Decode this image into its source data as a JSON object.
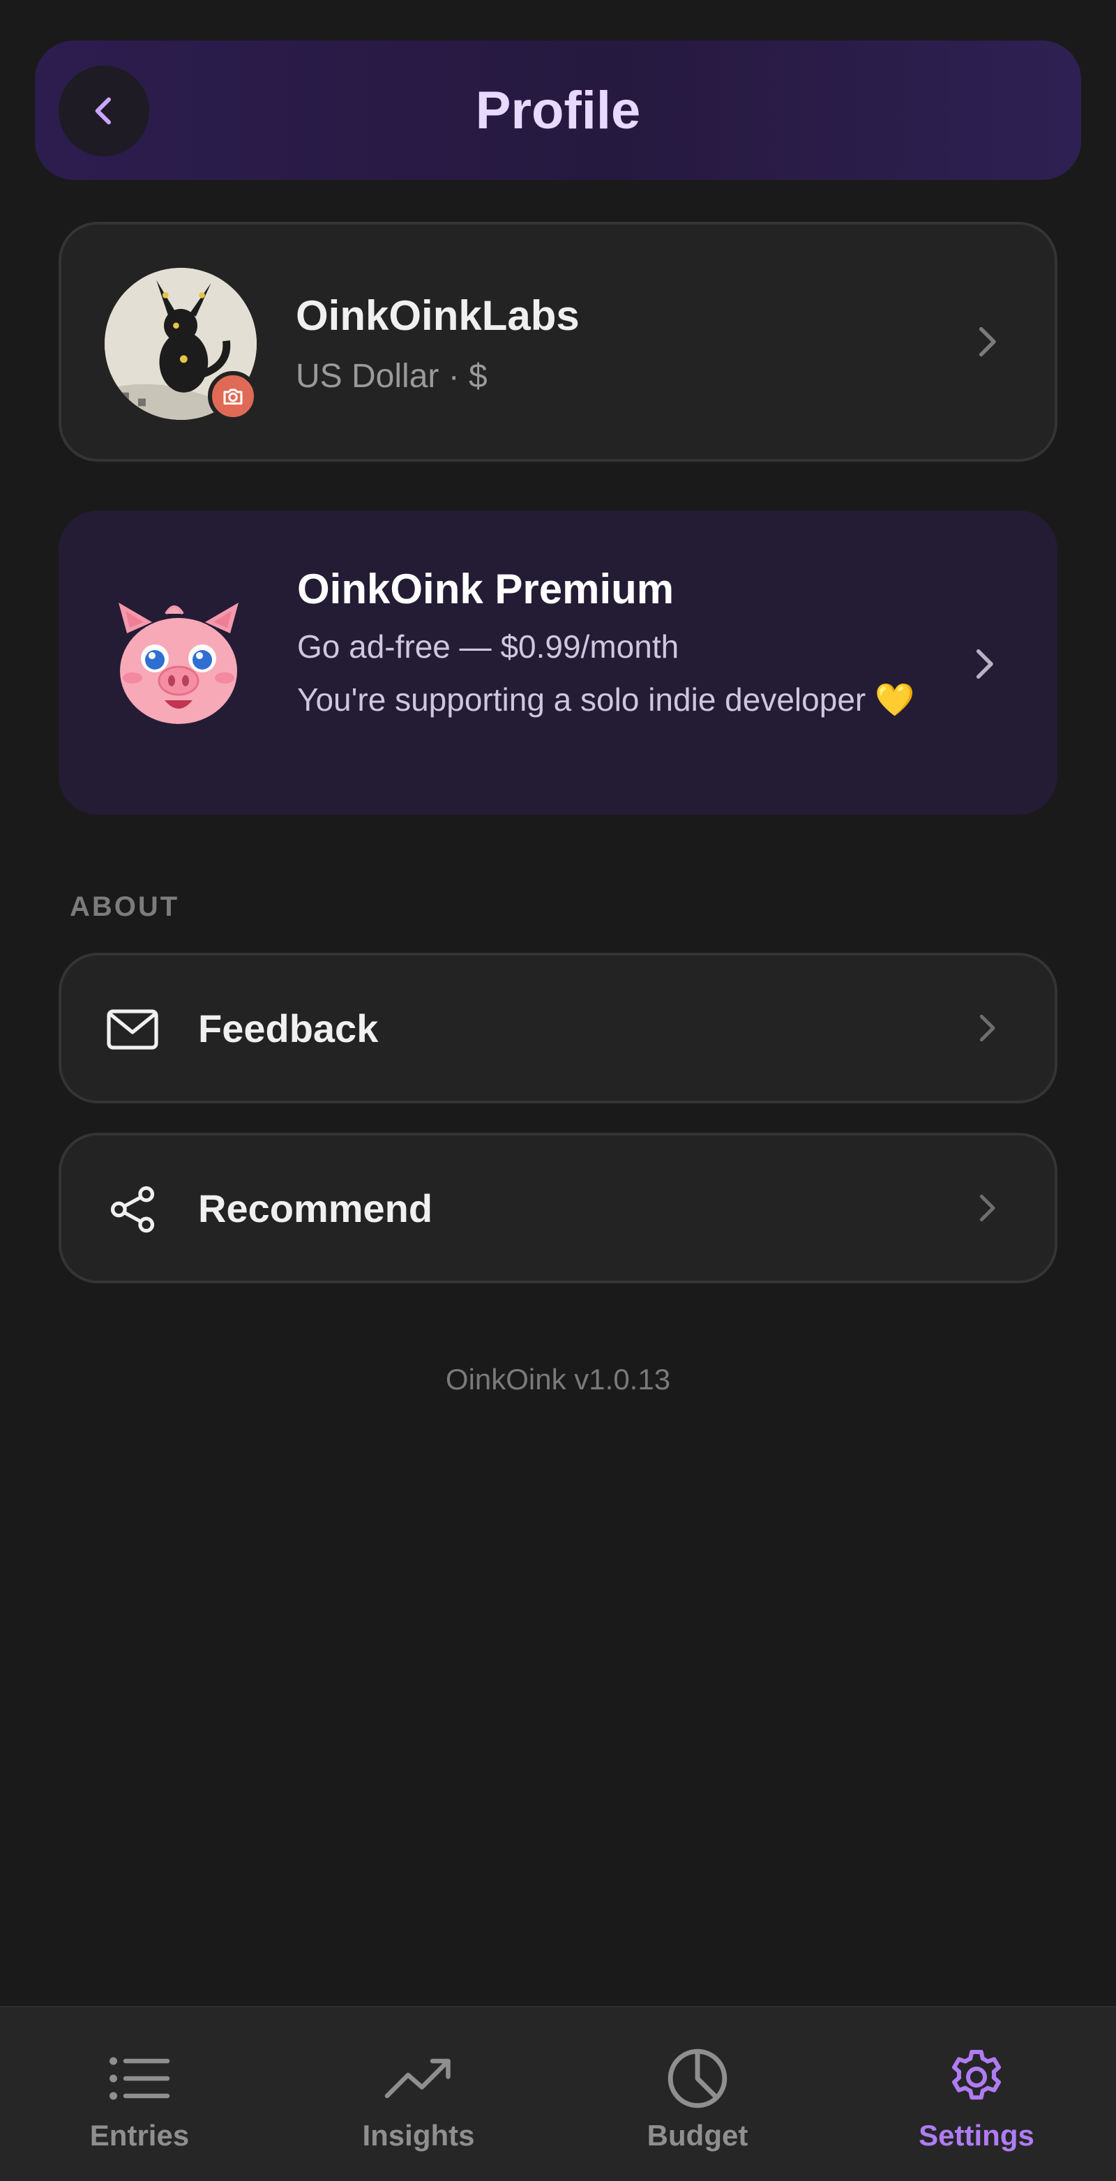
{
  "header": {
    "title": "Profile"
  },
  "profile": {
    "name": "OinkOinkLabs",
    "currency": "US Dollar · $"
  },
  "premium": {
    "title": "OinkOink Premium",
    "price_line": "Go ad-free — $0.99/month",
    "support_line": "You're supporting a solo indie developer 💛"
  },
  "about": {
    "section_label": "ABOUT",
    "items": [
      {
        "label": "Feedback",
        "icon": "mail-icon"
      },
      {
        "label": "Recommend",
        "icon": "share-icon"
      }
    ]
  },
  "version": "OinkOink v1.0.13",
  "bottom_nav": {
    "items": [
      {
        "label": "Entries",
        "icon": "list-icon",
        "active": false
      },
      {
        "label": "Insights",
        "icon": "trend-icon",
        "active": false
      },
      {
        "label": "Budget",
        "icon": "pie-chart-icon",
        "active": false
      },
      {
        "label": "Settings",
        "icon": "gear-icon",
        "active": true
      }
    ]
  },
  "colors": {
    "accent": "#b07cf5",
    "header_bg": "#2c1d4f",
    "background": "#1a1a1a",
    "card_bg": "#232323",
    "camera_badge": "#e06a55"
  }
}
